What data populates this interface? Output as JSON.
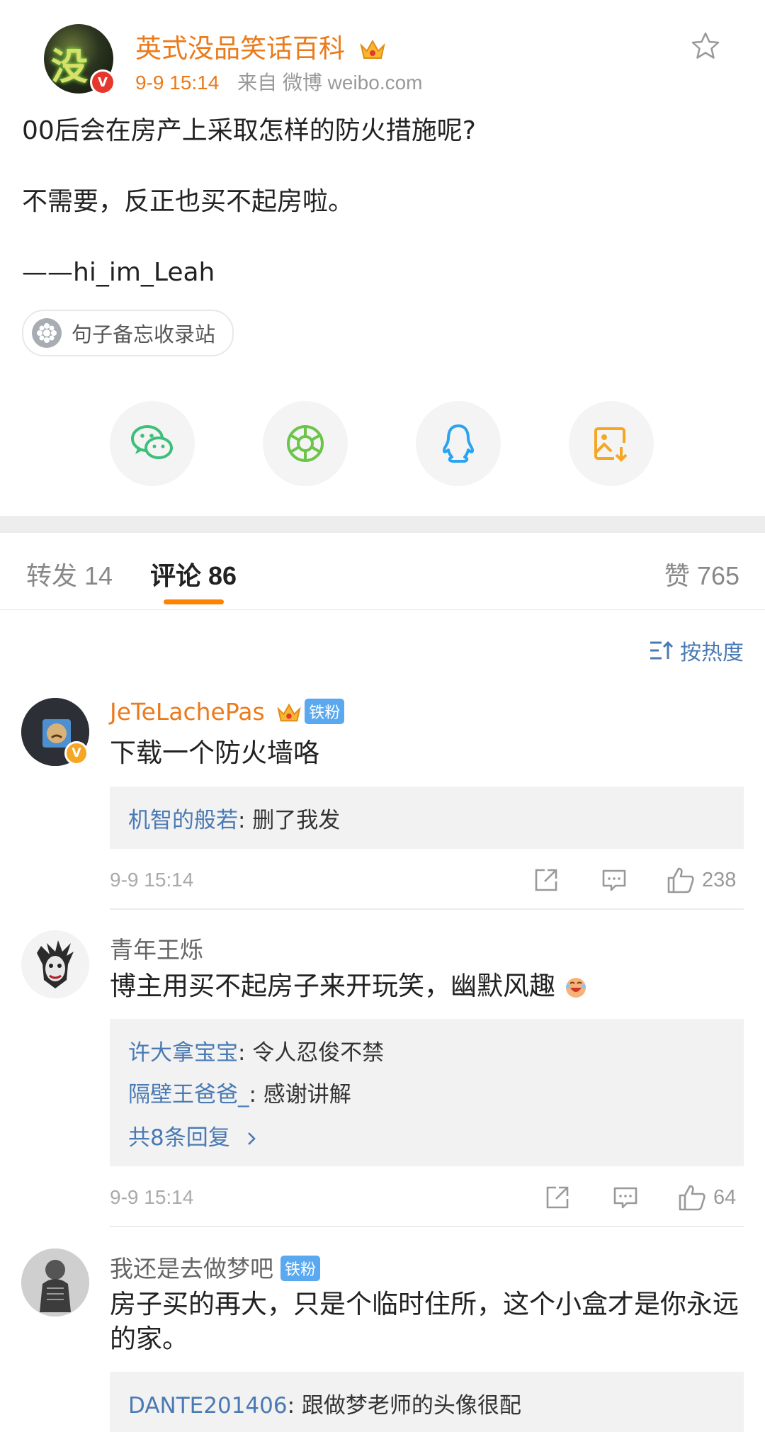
{
  "post": {
    "author": "英式没品笑话百科",
    "time": "9-9 15:14",
    "source": "来自 微博 weibo.com",
    "lines": [
      "00后会在房产上采取怎样的防火措施呢?",
      "不需要，反正也买不起房啦。",
      "——hi_im_Leah"
    ],
    "topic": "句子备忘收录站"
  },
  "share": [
    "wechat-icon",
    "moments-icon",
    "qq-icon",
    "save-image-icon"
  ],
  "tabs": {
    "repost": "转发 14",
    "comment": "评论 86",
    "like": "赞 765"
  },
  "sort_label": "按热度",
  "comments": [
    {
      "name": "JeTeLachePas",
      "fan_badge": "铁粉",
      "text": "下载一个防火墙咯",
      "replies": [
        {
          "who": "机智的般若",
          "text": ": 删了我发"
        }
      ],
      "time": "9-9 15:14",
      "likes": "238"
    },
    {
      "name": "青年王烁",
      "text": "博主用买不起房子来开玩笑，幽默风趣",
      "replies": [
        {
          "who": "许大拿宝宝",
          "text": ": 令人忍俊不禁"
        },
        {
          "who": "隔壁王爸爸_",
          "text": ": 感谢讲解"
        }
      ],
      "more": "共8条回复",
      "time": "9-9 15:14",
      "likes": "64"
    },
    {
      "name": "我还是去做梦吧",
      "fan_badge": "铁粉",
      "text": "房子买的再大，只是个临时住所，这个小盒才是你永远的家。",
      "replies": [
        {
          "who": "DANTE201406",
          "text": ": 跟做梦老师的头像很配"
        }
      ]
    }
  ],
  "colors": {
    "accent": "#ff8200",
    "name_orange": "#eb7a1b",
    "link_blue": "#4a7ab3"
  }
}
